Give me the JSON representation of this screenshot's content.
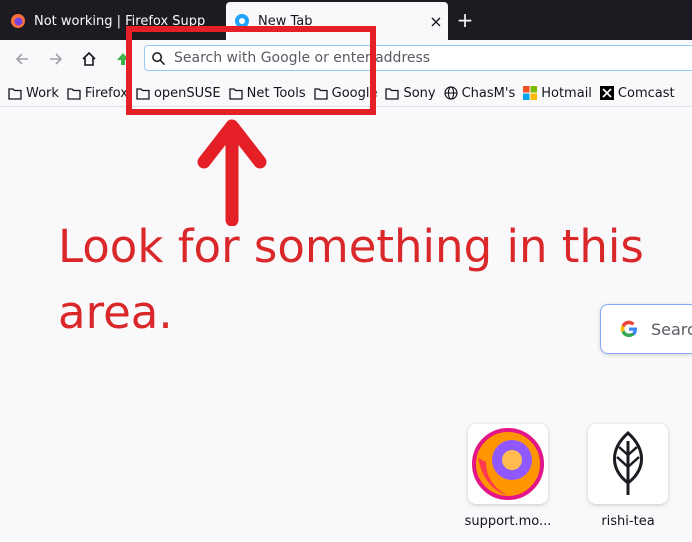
{
  "tabs": [
    {
      "title": "Not working | Firefox Supp",
      "icon": "firefox-icon"
    },
    {
      "title": "New Tab",
      "icon": "firefox-newtab-icon",
      "close": "×"
    }
  ],
  "new_tab": "+",
  "urlbar": {
    "placeholder": "Search with Google or enter address"
  },
  "bookmarks": [
    {
      "label": "Work",
      "icon": "folder-icon"
    },
    {
      "label": "Firefox",
      "icon": "folder-icon"
    },
    {
      "label": "openSUSE",
      "icon": "folder-icon"
    },
    {
      "label": "Net Tools",
      "icon": "folder-icon"
    },
    {
      "label": "Google",
      "icon": "folder-icon"
    },
    {
      "label": "Sony",
      "icon": "folder-icon"
    },
    {
      "label": "ChasM's",
      "icon": "globe-icon"
    },
    {
      "label": "Hotmail",
      "icon": "microsoft-icon"
    },
    {
      "label": "Comcast",
      "icon": "x-icon"
    }
  ],
  "annotation": {
    "text": "Look for something in this area.",
    "color": "#e41f25"
  },
  "newtab_search": {
    "placeholder": "Search"
  },
  "top_sites": [
    {
      "label": "support.mo...",
      "icon": "firefox-logo-icon"
    },
    {
      "label": "rishi-tea",
      "icon": "leaf-icon"
    }
  ]
}
